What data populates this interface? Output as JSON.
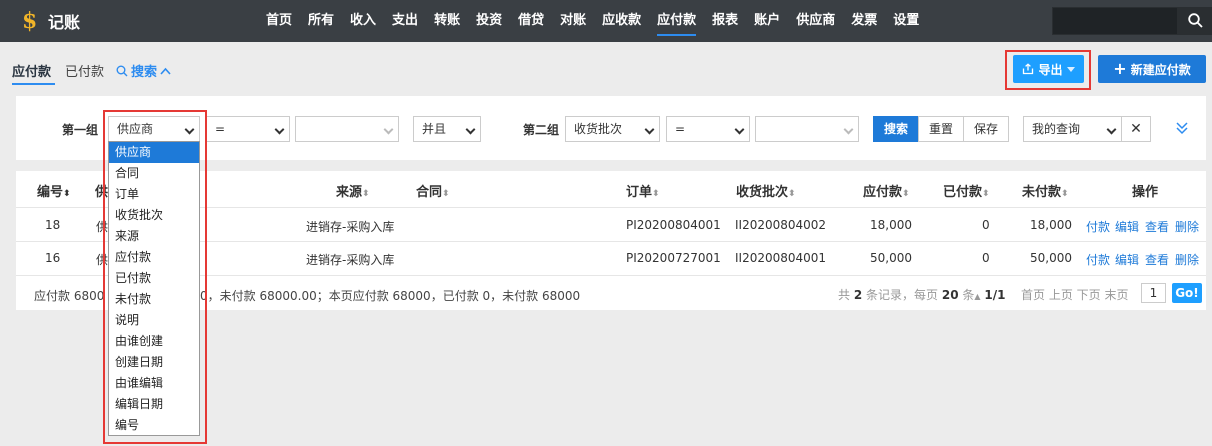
{
  "app": {
    "logo_glyph": "$",
    "name": "记账"
  },
  "nav": [
    "首页",
    "所有",
    "收入",
    "支出",
    "转账",
    "投资",
    "借贷",
    "对账",
    "应收款",
    "应付款",
    "报表",
    "账户",
    "供应商",
    "发票",
    "设置"
  ],
  "nav_active": "应付款",
  "tabs": {
    "payable": "应付款",
    "paid": "已付款",
    "search": "搜索"
  },
  "buttons": {
    "export": "导出",
    "new": "新建应付款"
  },
  "filter": {
    "group1_label": "第一组",
    "group1_field": "供应商",
    "group1_op": "=",
    "group1_value": "",
    "connector": "并且",
    "group2_label": "第二组",
    "group2_field": "收货批次",
    "group2_op": "=",
    "group2_value": "",
    "search_btn": "搜索",
    "reset_btn": "重置",
    "save_btn": "保存",
    "my_query": "我的查询",
    "clear": "✕"
  },
  "dropdown_options": [
    "供应商",
    "合同",
    "订单",
    "收货批次",
    "来源",
    "应付款",
    "已付款",
    "未付款",
    "说明",
    "由谁创建",
    "创建日期",
    "由谁编辑",
    "编辑日期",
    "编号"
  ],
  "table": {
    "headers": {
      "id": "编号",
      "supplier": "供",
      "source": "来源",
      "contract": "合同",
      "order": "订单",
      "batch": "收货批次",
      "payable": "应付款",
      "paid": "已付款",
      "unpaid": "未付款",
      "actions": "操作"
    },
    "rows": [
      {
        "id": "18",
        "supplier": "供",
        "source": "进销存-采购入库",
        "order": "PI20200804001",
        "batch": "II20200804002",
        "payable": "18,000",
        "paid": "0",
        "unpaid": "18,000"
      },
      {
        "id": "16",
        "supplier": "供",
        "source": "进销存-采购入库",
        "order": "PI20200727001",
        "batch": "II20200804001",
        "payable": "50,000",
        "paid": "0",
        "unpaid": "50,000"
      }
    ],
    "actions": [
      "付款",
      "编辑",
      "查看",
      "删除"
    ],
    "summary_left": "应付款 6800",
    "summary_right": "0，未付款 68000.00；本页应付款 68000，已付款 0，未付款 68000",
    "pager": {
      "total_prefix": "共",
      "total": "2",
      "total_suffix": "条记录，每页",
      "per_page": "20",
      "per_suffix": "条",
      "pages": "1/1",
      "links": "首页 上页 下页 末页",
      "page": "1",
      "go": "Go!"
    }
  },
  "colors": {
    "topbar": "#3a3f44",
    "accent": "#1e7ad8",
    "export": "#1e9fff",
    "highlight": "#e53935"
  }
}
